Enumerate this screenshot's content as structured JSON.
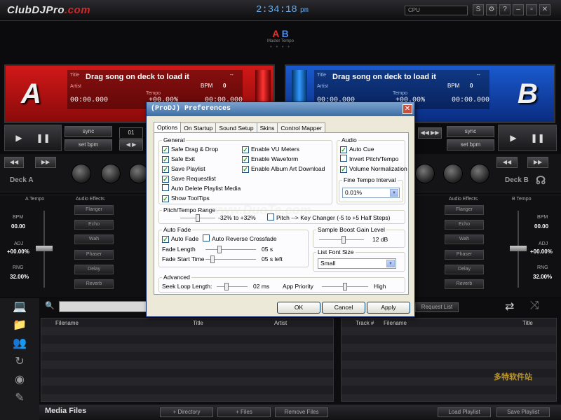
{
  "app": {
    "logo_main": "ClubDJPro",
    "logo_domain": ".com",
    "clock": "2:34:18",
    "ampm": "pm",
    "cpu_label": "CPU",
    "window_buttons": [
      "S",
      "⚙",
      "?",
      "–",
      "▫",
      "✕"
    ]
  },
  "master": {
    "a": "A",
    "b": "B",
    "label": "Master Tempo",
    "dots": "• • • •"
  },
  "deck_a": {
    "letter": "A",
    "title_label": "Title",
    "artist_label": "Artist",
    "song": "Drag song on deck to load it",
    "dashes": "--",
    "bpm_label": "BPM",
    "bpm": "0",
    "time_left": "00:00.000",
    "tempo_label": "Tempo",
    "tempo": "+00.00%",
    "time_right": "00:00.000",
    "loop_num": "01",
    "sync": "sync",
    "setbpm": "set bpm",
    "name": "Deck A"
  },
  "deck_b": {
    "letter": "B",
    "title_label": "Title",
    "artist_label": "Artist",
    "song": "Drag song on deck to load it",
    "dashes": "--",
    "bpm_label": "BPM",
    "bpm": "0",
    "time_left": "00:00.000",
    "tempo_label": "Tempo",
    "tempo": "+00.00%",
    "time_right": "00:00.000",
    "sync": "sync",
    "setbpm": "set bpm",
    "name": "Deck B"
  },
  "left_panel": {
    "tempo_title": "A Tempo",
    "fx_title": "Audio Effects",
    "bpm_label": "BPM",
    "bpm": "00.00",
    "adj_label": "ADJ",
    "adj": "+00.00%",
    "rng_label": "RNG",
    "rng": "32.00%",
    "effects": [
      "Flanger",
      "Echo",
      "Wah",
      "Phaser",
      "Delay",
      "Reverb"
    ]
  },
  "right_panel": {
    "tempo_title": "B Tempo",
    "fx_title": "Audio Effects",
    "bpm_label": "BPM",
    "bpm": "00.00",
    "adj_label": "ADJ",
    "adj": "+00.00%",
    "rng_label": "RNG",
    "rng": "32.00%",
    "effects": [
      "Flanger",
      "Echo",
      "Wah",
      "Phaser",
      "Delay",
      "Reverb"
    ]
  },
  "library": {
    "cols_left": [
      "Filename",
      "Title",
      "Artist"
    ],
    "cols_right": [
      "Track #",
      "Filename",
      "Title"
    ],
    "request_list": "Request List",
    "media_files": "Media Files",
    "add_directory": "+ Directory",
    "add_files": "+ Files",
    "remove_files": "Remove Files",
    "load_playlist": "Load Playlist",
    "save_playlist": "Save Playlist",
    "watermark": "www.DuoTe.com",
    "watermark_cn": "多特软件站"
  },
  "dialog": {
    "title": "(ProDJ) Preferences",
    "close": "✕",
    "tabs": [
      "Options",
      "On Startup",
      "Sound Setup",
      "Skins",
      "Control Mapper"
    ],
    "general": {
      "title": "General",
      "left": [
        {
          "label": "Safe Drag & Drop",
          "checked": true
        },
        {
          "label": "Safe Exit",
          "checked": true
        },
        {
          "label": "Save Playlist",
          "checked": true
        },
        {
          "label": "Save Requestlist",
          "checked": true
        },
        {
          "label": "Auto Delete Playlist Media",
          "checked": false
        },
        {
          "label": "Show ToolTips",
          "checked": true
        }
      ],
      "right": [
        {
          "label": "Enable VU Meters",
          "checked": true
        },
        {
          "label": "Enable Waveform",
          "checked": true
        },
        {
          "label": "Enable Album Art Download",
          "checked": true
        }
      ]
    },
    "audio": {
      "title": "Audio",
      "items": [
        {
          "label": "Auto Cue",
          "checked": true
        },
        {
          "label": "Invert Pitch/Tempo",
          "checked": false
        },
        {
          "label": "Volume Normalization",
          "checked": true
        }
      ],
      "fine_title": "Fine Tempo Interval",
      "fine_value": "0.01%"
    },
    "pitch": {
      "title": "Pitch/Tempo Range",
      "range": "-32% to +32%",
      "key_changer": "Pitch --> Key Changer (-5 to +5 Half Steps)",
      "key_checked": false,
      "slider_pos": 0.5
    },
    "autofade": {
      "title": "Auto Fade",
      "auto_fade": "Auto Fade",
      "auto_fade_checked": true,
      "reverse": "Auto Reverse Crossfade",
      "reverse_checked": false,
      "fade_length_label": "Fade Length",
      "fade_length": "05 s",
      "fade_length_pos": 0.25,
      "fade_start_label": "Fade Start Time",
      "fade_start": "05 s left",
      "fade_start_pos": 0.1
    },
    "sample": {
      "title": "Sample Boost Gain Level",
      "value": "12 dB",
      "pos": 0.55
    },
    "listfont": {
      "title": "List Font Size",
      "value": "Small"
    },
    "advanced": {
      "title": "Advanced",
      "seek_label": "Seek Loop Length:",
      "seek": "02 ms",
      "seek_pos": 0.3,
      "priority_label": "App Priority",
      "priority": "High",
      "priority_pos": 0.5
    },
    "ok": "OK",
    "cancel": "Cancel",
    "apply": "Apply"
  }
}
